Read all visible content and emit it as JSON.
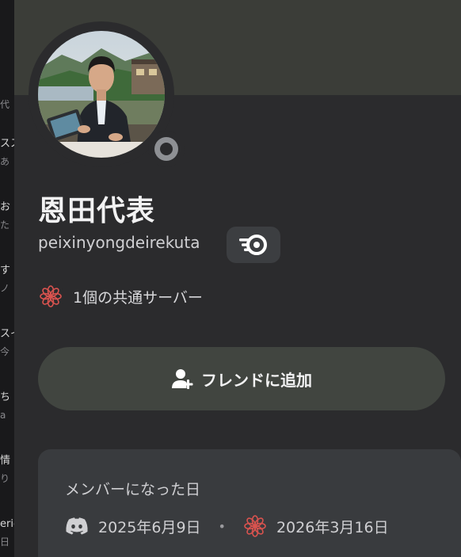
{
  "background_list": {
    "items": [
      {
        "t1": "",
        "t2": "代"
      },
      {
        "t1": "スス",
        "t2": "あ"
      },
      {
        "t1": "お",
        "t2": "た"
      },
      {
        "t1": "す",
        "t2": "ノ"
      },
      {
        "t1": "スイ",
        "t2": "今"
      },
      {
        "t1": "ち",
        "t2": "a"
      },
      {
        "t1": "情",
        "t2": "り"
      },
      {
        "t1": "eric",
        "t2": "日"
      }
    ]
  },
  "profile": {
    "display_name": "恩田代表",
    "username": "peixinyongdeirekuta",
    "status": "offline",
    "mutual_servers_label": "1個の共通サーバー",
    "add_friend_label": "フレンドに追加",
    "member_since": {
      "heading": "メンバーになった日",
      "discord_date": "2025年6月9日",
      "separator": "•",
      "server_date": "2026年3月16日"
    }
  },
  "colors": {
    "sheet_bg": "#2b2b2d",
    "banner": "#3b3d38",
    "add_friend_bg": "#414540",
    "card_bg": "#393b3e",
    "server_icon_accent": "#d9534f"
  },
  "icons": {
    "status": "offline-status-icon",
    "badge": "nitro-badge-icon",
    "server": "server-flower-icon",
    "add_friend": "add-friend-icon",
    "discord": "discord-logo-icon"
  }
}
